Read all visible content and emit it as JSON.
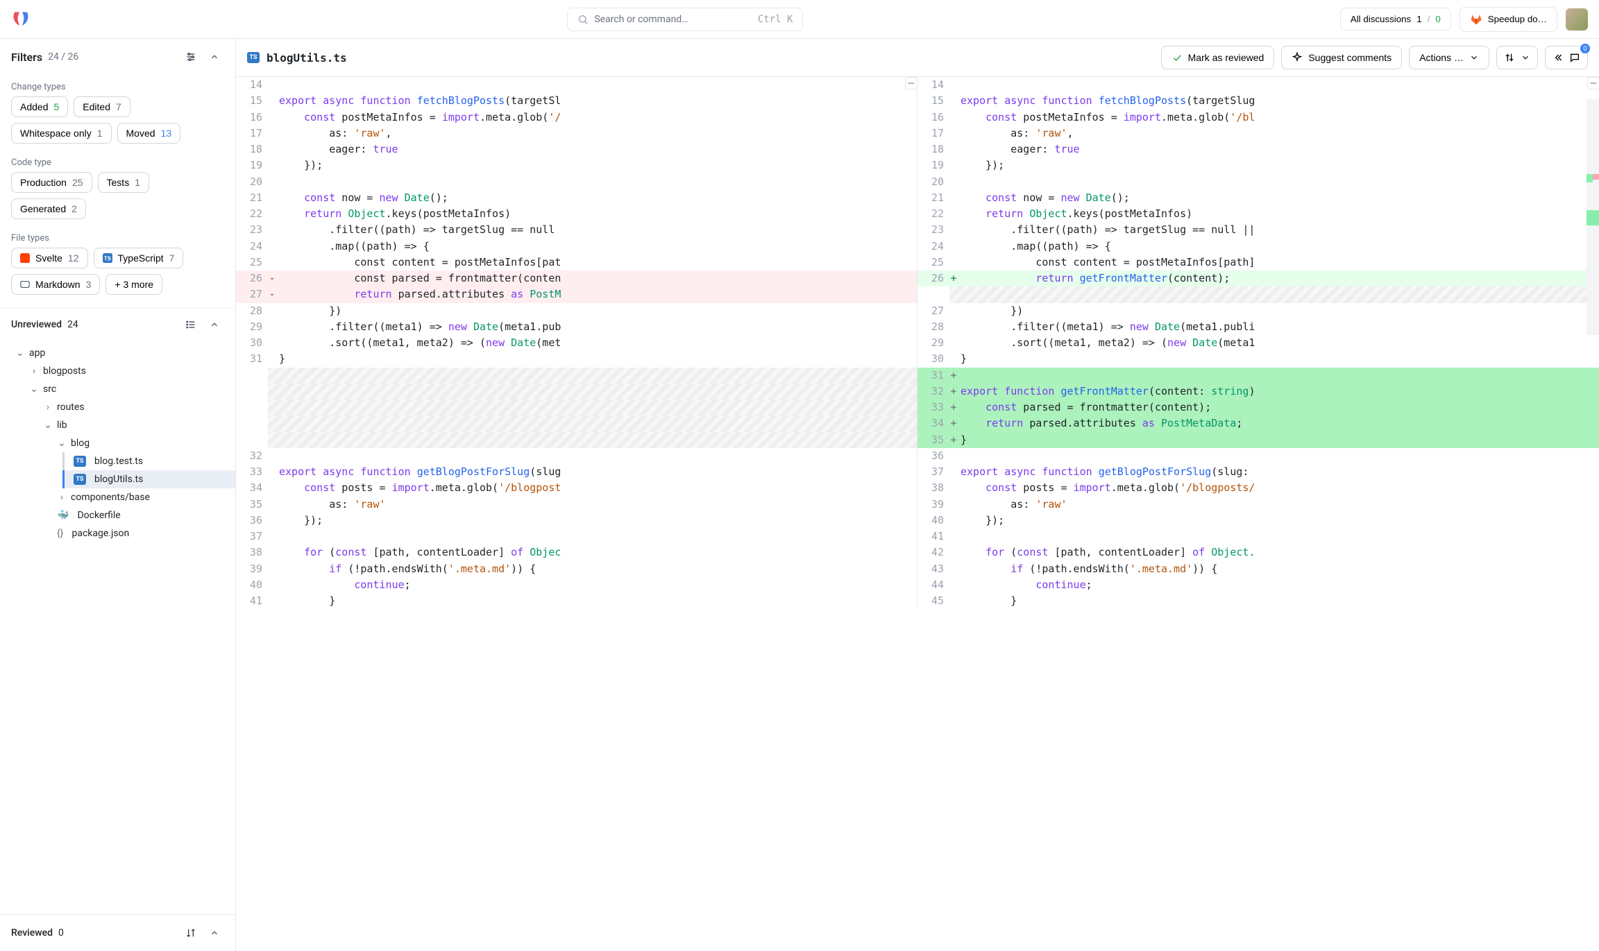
{
  "search": {
    "placeholder": "Search or command…",
    "shortcut": "Ctrl  K"
  },
  "topbar": {
    "discussions_label": "All discussions",
    "discussions_a": "1",
    "discussions_b": "0",
    "mr_label": "Speedup do…"
  },
  "filters": {
    "title": "Filters",
    "count": "24 / 26",
    "change_types_label": "Change types",
    "added": {
      "label": "Added",
      "count": "5"
    },
    "edited": {
      "label": "Edited",
      "count": "7"
    },
    "whitespace": {
      "label": "Whitespace only",
      "count": "1"
    },
    "moved": {
      "label": "Moved",
      "count": "13"
    },
    "code_type_label": "Code type",
    "production": {
      "label": "Production",
      "count": "25"
    },
    "tests": {
      "label": "Tests",
      "count": "1"
    },
    "generated": {
      "label": "Generated",
      "count": "2"
    },
    "file_types_label": "File types",
    "svelte": {
      "label": "Svelte",
      "count": "12"
    },
    "typescript": {
      "label": "TypeScript",
      "count": "7"
    },
    "markdown": {
      "label": "Markdown",
      "count": "3"
    },
    "more": "+ 3 more"
  },
  "unreviewed": {
    "title": "Unreviewed",
    "count": "24"
  },
  "reviewed": {
    "title": "Reviewed",
    "count": "0"
  },
  "tree": {
    "app": "app",
    "blogposts": "blogposts",
    "src": "src",
    "routes": "routes",
    "lib": "lib",
    "blog": "blog",
    "blog_test": "blog.test.ts",
    "blog_utils": "blogUtils.ts",
    "components_base": "components/base",
    "dockerfile": "Dockerfile",
    "package_json": "package.json"
  },
  "header": {
    "filename": "blogUtils.ts",
    "mark_reviewed": "Mark as reviewed",
    "suggest": "Suggest comments",
    "actions": "Actions …",
    "comment_count": "0"
  },
  "code": {
    "l14": "",
    "l15_a": "export",
    "l15_b": "async",
    "l15_c": "function",
    "l15_d": "fetchBlogPosts",
    "l15_e": "(targetSl",
    "r15_e": "(targetSlug",
    "l16_a": "    const",
    "l16_b": " postMetaInfos = ",
    "l16_c": "import",
    "l16_d": ".meta.glob(",
    "l16_e": "'/",
    "r16_e": "'/bl",
    "l17_a": "        as: ",
    "l17_b": "'raw'",
    "l17_c": ",",
    "l18_a": "        eager: ",
    "l18_b": "true",
    "l19": "    });",
    "l20": "",
    "l21_a": "    const",
    "l21_b": " now = ",
    "l21_c": "new",
    "l21_d": " Date",
    "l21_e": "();",
    "l22_a": "    return",
    "l22_b": " Object",
    "l22_c": ".keys(postMetaInfos)",
    "l23": "        .filter((path) => targetSlug == null",
    "r23": "        .filter((path) => targetSlug == null ||",
    "l24": "        .map((path) => {",
    "l25": "            const content = postMetaInfos[pat",
    "r25": "            const content = postMetaInfos[path]",
    "l26": "            const parsed = frontmatter(conten",
    "r26_a": "            return",
    "r26_b": " getFrontMatter",
    "r26_c": "(content);",
    "l27_a": "            return",
    "l27_b": " parsed.attributes ",
    "l27_c": "as",
    "l27_d": " PostM",
    "l28": "        })",
    "l29_a": "        .filter((meta1) => ",
    "l29_b": "new",
    "l29_c": " Date",
    "l29_d": "(meta1.pub",
    "r29_d": "(meta1.publi",
    "l30_a": "        .sort((meta1, meta2) => (",
    "l30_b": "new",
    "l30_c": " Date",
    "l30_d": "(met",
    "r30_d": "(meta1",
    "l31": "}",
    "r31": "",
    "r32_a": "export",
    "r32_b": "function",
    "r32_c": "getFrontMatter",
    "r32_d": "(content: ",
    "r32_e": "string",
    "r32_f": ")",
    "r33_a": "    const",
    "r33_b": " parsed = frontmatter(content);",
    "r34_a": "    return",
    "r34_b": " parsed.attributes ",
    "r34_c": "as",
    "r34_d": " PostMetaData",
    "r34_e": ";",
    "r35": "}",
    "l32": "",
    "l33_a": "export",
    "l33_b": "async",
    "l33_c": "function",
    "l33_d": "getBlogPostForSlug",
    "l33_e": "(slug",
    "r37_e": "(slug:",
    "l34_a": "    const",
    "l34_b": " posts = ",
    "l34_c": "import",
    "l34_d": ".meta.glob(",
    "l34_e": "'/blogpost",
    "r38_e": "'/blogposts/",
    "l35_a": "        as: ",
    "l35_b": "'raw'",
    "l36": "    });",
    "l37": "",
    "l38_a": "    for",
    "l38_b": " (",
    "l38_c": "const",
    "l38_d": " [path, contentLoader] ",
    "l38_e": "of",
    "l38_f": " Objec",
    "r42_f": " Object.",
    "l39_a": "        if",
    "l39_b": " (!path.endsWith(",
    "l39_c": "'.meta.md'",
    "l39_d": ")) {",
    "l40_a": "            continue",
    "l40_b": ";",
    "l41": "        }"
  }
}
